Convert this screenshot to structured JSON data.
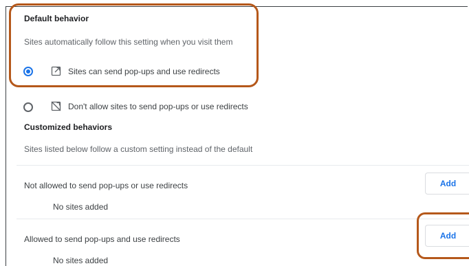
{
  "default_behavior": {
    "heading": "Default behavior",
    "description": "Sites automatically follow this setting when you visit them",
    "options": [
      {
        "label": "Sites can send pop-ups and use redirects",
        "selected": true,
        "icon": "popup-allowed-icon"
      },
      {
        "label": "Don't allow sites to send pop-ups or use redirects",
        "selected": false,
        "icon": "popup-blocked-icon"
      }
    ]
  },
  "customized_behaviors": {
    "heading": "Customized behaviors",
    "description": "Sites listed below follow a custom setting instead of the default",
    "sections": [
      {
        "label": "Not allowed to send pop-ups or use redirects",
        "button_label": "Add",
        "empty_text": "No sites added"
      },
      {
        "label": "Allowed to send pop-ups and use redirects",
        "button_label": "Add",
        "empty_text": "No sites added"
      }
    ]
  },
  "colors": {
    "accent": "#1a73e8",
    "annotation": "#b5581a"
  }
}
